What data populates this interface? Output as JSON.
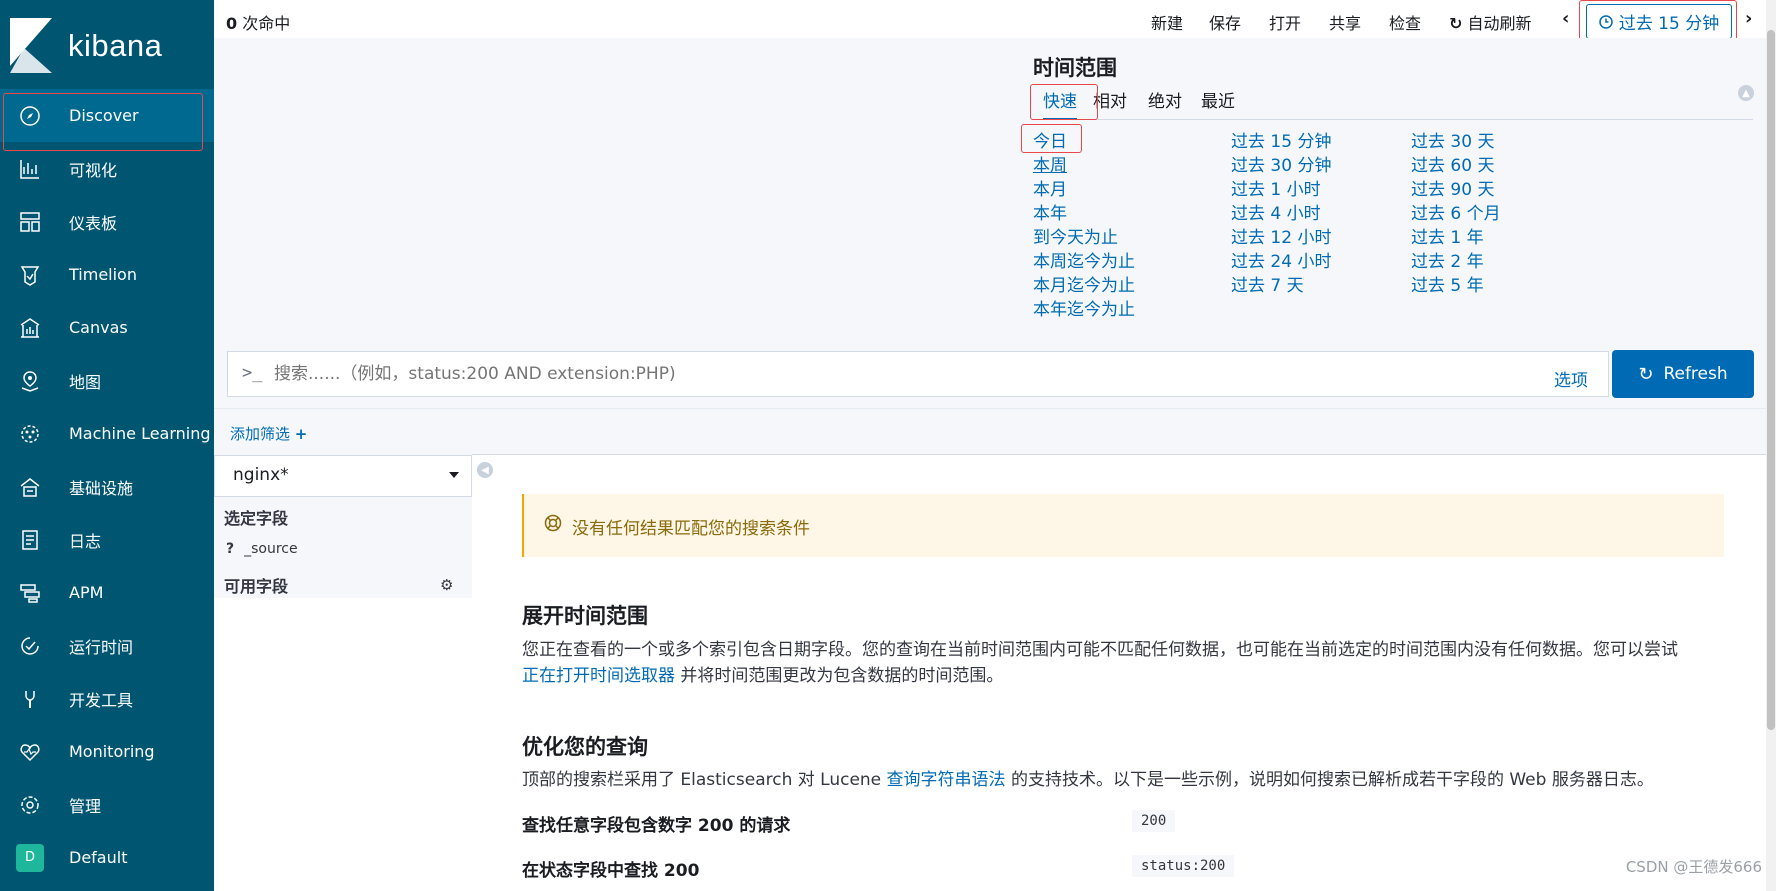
{
  "app": {
    "logo_text": "kibana",
    "watermark": "CSDN @王德发666"
  },
  "sidebar": {
    "items": [
      {
        "label": "Discover",
        "icon": "compass-icon"
      },
      {
        "label": "可视化",
        "icon": "visualize-icon"
      },
      {
        "label": "仪表板",
        "icon": "dashboard-icon"
      },
      {
        "label": "Timelion",
        "icon": "timelion-icon"
      },
      {
        "label": "Canvas",
        "icon": "canvas-icon"
      },
      {
        "label": "地图",
        "icon": "map-icon"
      },
      {
        "label": "Machine Learning",
        "icon": "machine-learning-icon"
      },
      {
        "label": "基础设施",
        "icon": "infrastructure-icon"
      },
      {
        "label": "日志",
        "icon": "logs-icon"
      },
      {
        "label": "APM",
        "icon": "apm-icon"
      },
      {
        "label": "运行时间",
        "icon": "uptime-icon"
      },
      {
        "label": "开发工具",
        "icon": "dev-tools-icon"
      },
      {
        "label": "Monitoring",
        "icon": "monitoring-icon"
      },
      {
        "label": "管理",
        "icon": "gear-icon"
      },
      {
        "label": "Default",
        "avatar": "D"
      }
    ]
  },
  "topbar": {
    "hits_count": "0",
    "hits_label": " 次命中",
    "menu": [
      "新建",
      "保存",
      "打开",
      "共享",
      "检查",
      "自动刷新"
    ],
    "time_button": "过去 15 分钟"
  },
  "time_panel": {
    "title": "时间范围",
    "tabs": [
      "快速",
      "相对",
      "绝对",
      "最近"
    ],
    "col1": [
      "今日",
      "本周",
      "本月",
      "本年",
      "到今天为止",
      "本周迄今为止",
      "本月迄今为止",
      "本年迄今为止"
    ],
    "col2": [
      "过去 15 分钟",
      "过去 30 分钟",
      "过去 1 小时",
      "过去 4 小时",
      "过去 12 小时",
      "过去 24 小时",
      "过去 7 天"
    ],
    "col3": [
      "过去 30 天",
      "过去 60 天",
      "过去 90 天",
      "过去 6 个月",
      "过去 1 年",
      "过去 2 年",
      "过去 5 年"
    ]
  },
  "search": {
    "prompt": ">_",
    "placeholder": "搜索......（例如，status:200 AND extension:PHP)",
    "options_label": "选项",
    "refresh_label": "Refresh"
  },
  "filter": {
    "add_label": "添加筛选"
  },
  "fields_panel": {
    "index_pattern": "nginx*",
    "selected_header": "选定字段",
    "source_type": "?",
    "source_field": "_source",
    "available_header": "可用字段"
  },
  "main": {
    "callout": "没有任何结果匹配您的搜索条件",
    "section1_title": "展开时间范围",
    "section1_text": "您正在查看的一个或多个索引包含日期字段。您的查询在当前时间范围内可能不匹配任何数据，也可能在当前选定的时间范围内没有任何数据。您可以尝试",
    "section1_link": "正在打开时间选取器",
    "section1_tail": " 并将时间范围更改为包含数据的时间范围。",
    "section2_title": "优化您的查询",
    "section2_text1": "顶部的搜索栏采用了 Elasticsearch 对 Lucene ",
    "section2_link": "查询字符串语法",
    "section2_text2": " 的支持技术。以下是一些示例，说明如何搜索已解析成若干字段的 Web 服务器日志。",
    "examples": [
      {
        "label": "查找任意字段包含数字 200 的请求",
        "code": "200"
      },
      {
        "label": "在状态字段中查找 200",
        "code": "status:200"
      }
    ]
  },
  "colors": {
    "sidebar": "#005571",
    "sidebar_active": "#00698f",
    "link": "#006bb4",
    "accent_box": "#e8474c"
  }
}
